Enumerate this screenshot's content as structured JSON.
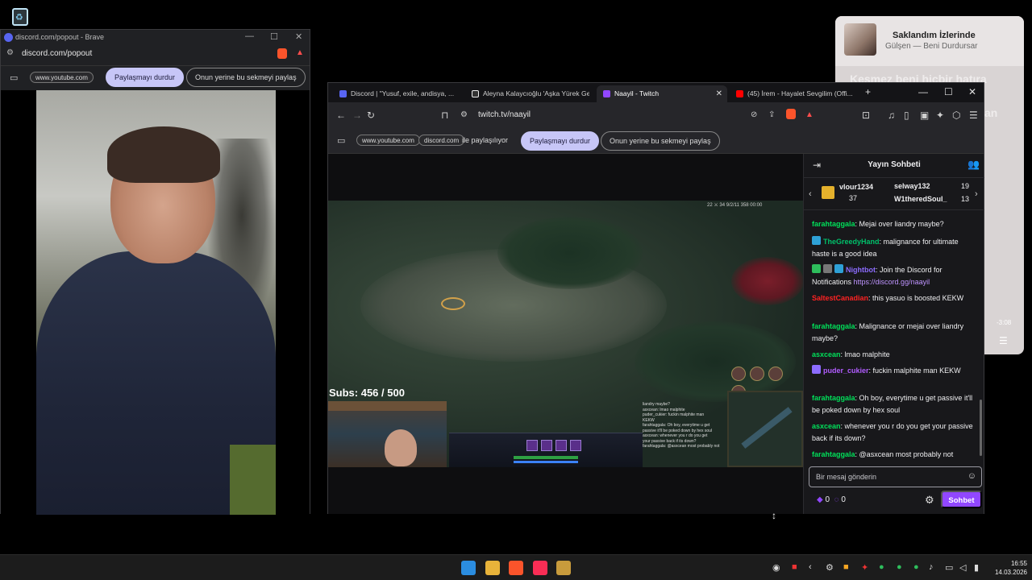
{
  "music": {
    "title": "Saklandım İzlerinde",
    "artist": "Gülşen — Beni Durdursar",
    "lyric_line_1": "Kesmez beni hiçbir hatıra",
    "lyric_line_2": "an",
    "time": "-3:08"
  },
  "popout": {
    "window_title": "discord.com/popout - Brave",
    "url": "discord.com/popout",
    "share_chip": "www.youtube.com",
    "stop_sharing": "Paylaşmayı durdur",
    "share_this_tab": "Onun yerine bu sekmeyi paylaş"
  },
  "main": {
    "tabs": [
      {
        "label": "Discord | \"Yusuf, exile, andisya, ...",
        "color": "#5865f2"
      },
      {
        "label": "Aleyna Kalaycıoğlu 'Aşka Yürek Gere...",
        "color": "#000000"
      },
      {
        "label": "Naayil - Twitch",
        "color": "#9147ff"
      },
      {
        "label": "(45) İrem - Hayalet Sevgilim (Offi...",
        "color": "#ff0000"
      }
    ],
    "url": "twitch.tv/naayil",
    "share_chips": [
      "www.youtube.com",
      "discord.com"
    ],
    "sharing_text": "ile paylaşılıyor",
    "stop_sharing": "Paylaşmayı durdur",
    "share_this_tab": "Onun yerine bu sekmeyi paylaş"
  },
  "stream": {
    "subs_text": "Subs: 456 / 500",
    "hud_top": "22 ⚔ 34   9/2/11   358   00:00",
    "overlay_chat": [
      "liandry maybe?",
      "asxcean: lmao malphite",
      "puder_cukier: fuckin malphite man",
      "KEKW",
      "farahtaggala: Oh boy, everytime u get",
      "passive it'll be poked down by hex soul",
      "asxcean: whenever you r do you get",
      "your passive back if its down?",
      "farahtaggala: @asxcean most probably not"
    ]
  },
  "chat": {
    "title": "Yayın Sohbeti",
    "leaderboard": [
      {
        "name": "vlour1234",
        "count": "37"
      },
      {
        "name": "selway132",
        "count": "19"
      },
      {
        "name": "W1theredSoul_",
        "count": "13"
      }
    ],
    "messages": [
      {
        "user": "farahtaggala",
        "color": "#00e05a",
        "text": "Mejai over liandry maybe?"
      },
      {
        "user": "TheGreedyHand",
        "color": "#00c06a",
        "text": "malignance for ultimate haste is a good idea"
      },
      {
        "user": "Nightbot",
        "color": "#8c6cff",
        "text": "Join the Discord for Notifications ",
        "link": "https://discord.gg/naayil"
      },
      {
        "user": "SaltestCanadian",
        "color": "#ff2222",
        "text": "this yasuo is boosted KEKW"
      },
      {
        "user": "farahtaggala",
        "color": "#00e05a",
        "text": "Malignance or mejai over liandry maybe?"
      },
      {
        "user": "asxcean",
        "color": "#00e05a",
        "text": "lmao malphite"
      },
      {
        "user": "puder_cukier",
        "color": "#b15cff",
        "text": "fuckin malphite man KEKW"
      },
      {
        "user": "farahtaggala",
        "color": "#00e05a",
        "text": "Oh boy, everytime u get passive it'll be poked down by hex soul"
      },
      {
        "user": "asxcean",
        "color": "#00e05a",
        "text": "whenever you r do you get your passive back if its down?"
      },
      {
        "user": "farahtaggala",
        "color": "#00e05a",
        "text": "@asxcean most probably not"
      }
    ],
    "input_placeholder": "Bir mesaj gönderin",
    "points_1": "0",
    "points_2": "0",
    "send": "Sohbet"
  },
  "taskbar": {
    "time": "16:55",
    "date": "14.03.2026"
  }
}
